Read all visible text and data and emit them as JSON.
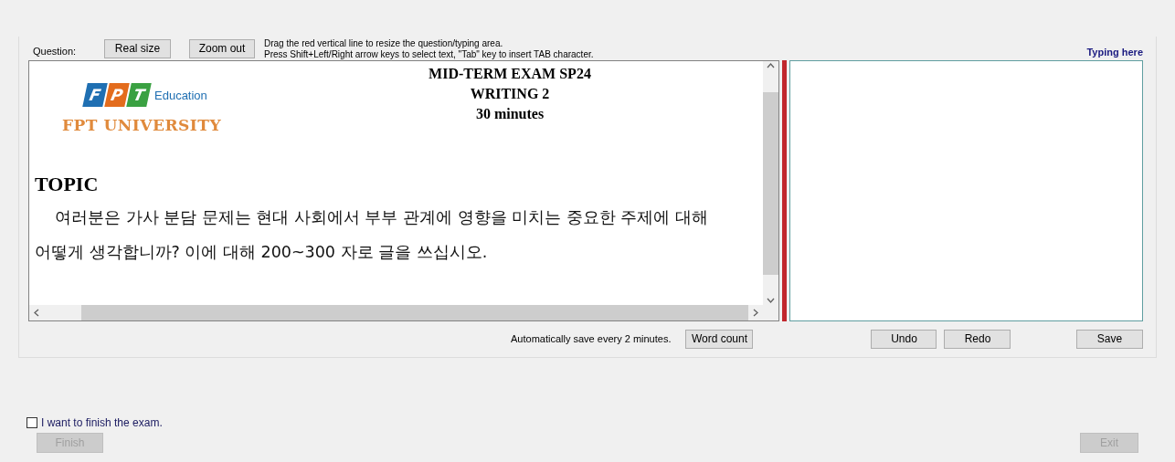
{
  "toolbar": {
    "label": "Question:",
    "buttons": [
      "Real size",
      "Zoom out"
    ],
    "hints": [
      "Drag the red vertical line to resize the question/typing area.",
      "Press Shift+Left/Right arrow keys to select text, \"Tab\" key to insert TAB character."
    ],
    "typing_label": "Typing here"
  },
  "question": {
    "logo": {
      "tiles": [
        "F",
        "P",
        "T"
      ],
      "caption": "Education",
      "name": "FPT UNIVERSITY"
    },
    "title_lines": [
      "MID-TERM EXAM SP24",
      "WRITING 2",
      "30 minutes"
    ],
    "heading": "TOPIC",
    "body": "여러분은  가사 분담 문제는 현대 사회에서 부부 관계에 영향을 미치는 중요한 주제에 대해 어떻게 생각합니까? 이에 대해 200~300 자로 글을 쓰십시오."
  },
  "bottom": {
    "autosave_note": "Automatically save every 2 minutes.",
    "word_count": "Word count",
    "undo": "Undo",
    "redo": "Redo",
    "save": "Save"
  },
  "finish": {
    "checkbox_label": "I want to finish the exam.",
    "checked": false,
    "finish_button": "Finish",
    "exit_button": "Exit",
    "exit_disabled": true
  }
}
